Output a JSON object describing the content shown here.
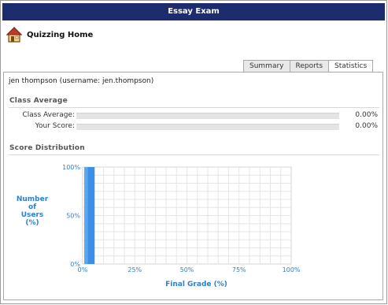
{
  "window": {
    "title": "Essay Exam"
  },
  "nav": {
    "home_label": "Quizzing Home"
  },
  "tabs": [
    {
      "label": "Summary",
      "active": false
    },
    {
      "label": "Reports",
      "active": false
    },
    {
      "label": "Statistics",
      "active": true
    }
  ],
  "user": {
    "line": "jen thompson (username: jen.thompson)"
  },
  "class_average_section": {
    "title": "Class Average",
    "rows": [
      {
        "label": "Class Average:",
        "value": "0.00%",
        "fraction": 0.0
      },
      {
        "label": "Your Score:",
        "value": "0.00%",
        "fraction": 0.0
      }
    ]
  },
  "distribution_section": {
    "title": "Score Distribution"
  },
  "chart_data": {
    "type": "bar",
    "x": [
      0,
      10,
      20,
      30,
      40,
      50,
      60,
      70,
      80,
      90
    ],
    "x_ticks": [
      "0%",
      "25%",
      "50%",
      "75%",
      "100%"
    ],
    "y_ticks": [
      "100%",
      "50%",
      "0%"
    ],
    "values": [
      100,
      0,
      0,
      0,
      0,
      0,
      0,
      0,
      0,
      0
    ],
    "xlabel": "Final Grade (%)",
    "ylabel_lines": [
      "Number",
      "of",
      "Users",
      "(%)"
    ],
    "xlim": [
      0,
      100
    ],
    "ylim": [
      0,
      100
    ],
    "grid": true,
    "bar_color": "#3d8fe6"
  },
  "colors": {
    "title_bar": "#1c2c6e",
    "axis_text": "#2f7fcf"
  }
}
